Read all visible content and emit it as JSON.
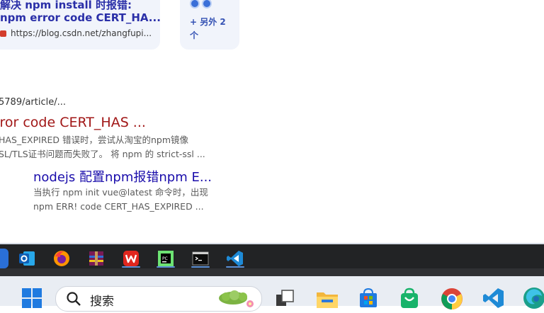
{
  "cards": {
    "main_card": {
      "title_line1": "解决 npm install 时报错:",
      "title_line2": "npm error code CERT_HA...",
      "url": "https://blog.csdn.net/zhangfupi..."
    },
    "more_card": {
      "label": "+ 另外 2 个"
    }
  },
  "results": {
    "breadcrumb": "5789/article/...",
    "result1": {
      "title": "rror code CERT_HAS ...",
      "snippet_line1": "HAS_EXPIRED 错误时，尝试从淘宝的npm镜像",
      "snippet_line2": "SL/TLS证书问题而失败了。 将 npm 的 strict-ssl ..."
    },
    "result2": {
      "title": "nodejs 配置npm报错npm E...",
      "snippet_line1": "当执行 npm init vue@latest 命令时，出现",
      "snippet_line2": "npm ERR! code CERT_HAS_EXPIRED ..."
    }
  },
  "app_bar": {
    "apps": [
      {
        "name": "outlook-icon",
        "color": "#1066c1"
      },
      {
        "name": "firefox-icon",
        "color": "#e8632b"
      },
      {
        "name": "winrar-icon",
        "color": "#8b1d5f"
      },
      {
        "name": "wps-office-icon",
        "color": "#e0261e"
      },
      {
        "name": "pycharm-icon",
        "color": "#21d789"
      },
      {
        "name": "terminal-icon",
        "color": "#111111"
      },
      {
        "name": "vscode-icon",
        "color": "#1e8ad6"
      }
    ]
  },
  "taskbar": {
    "search_label": "搜索",
    "icons": [
      {
        "name": "windows-start-icon",
        "color": "#1f7ae0"
      },
      {
        "name": "task-view-icon",
        "color": "#333333"
      },
      {
        "name": "file-explorer-icon",
        "color": "#f2b63c"
      },
      {
        "name": "microsoft-store-icon",
        "color": "#1f7ae0"
      },
      {
        "name": "shopping-bag-icon",
        "color": "#18b36a"
      },
      {
        "name": "chrome-icon",
        "color": "#db4437"
      },
      {
        "name": "vscode-taskbar-icon",
        "color": "#1e8ad6"
      },
      {
        "name": "edge-icon",
        "color": "#1a9f8a"
      }
    ]
  }
}
